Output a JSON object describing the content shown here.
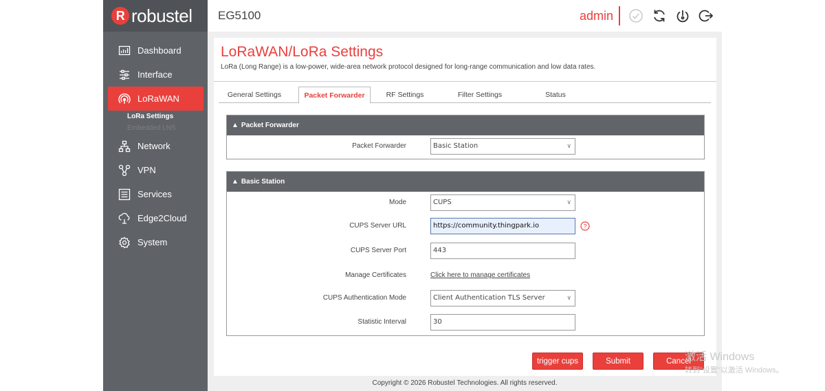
{
  "brand": {
    "logo_text": "robustel",
    "logo_mark": "R"
  },
  "header": {
    "device": "EG5100",
    "user": "admin",
    "icons": [
      "check-circle-icon",
      "refresh-icon",
      "power-icon",
      "logout-icon"
    ]
  },
  "sidebar": {
    "items": [
      {
        "label": "Dashboard",
        "icon": "dashboard-icon"
      },
      {
        "label": "Interface",
        "icon": "sliders-icon"
      },
      {
        "label": "LoRaWAN",
        "icon": "wireless-icon",
        "active": true
      },
      {
        "label": "Network",
        "icon": "network-icon"
      },
      {
        "label": "VPN",
        "icon": "vpn-icon"
      },
      {
        "label": "Services",
        "icon": "services-icon"
      },
      {
        "label": "Edge2Cloud",
        "icon": "cloud-icon"
      },
      {
        "label": "System",
        "icon": "gear-icon"
      }
    ],
    "subitems": [
      {
        "label": "LoRa Settings",
        "active": true
      },
      {
        "label": "Embedded LNS",
        "active": false
      }
    ]
  },
  "page": {
    "title": "LoRaWAN/LoRa Settings",
    "description": "LoRa (Long Range) is a low-power, wide-area network protocol designed for long-range communication and low data rates."
  },
  "tabs": [
    {
      "label": "General Settings"
    },
    {
      "label": "Packet Forwarder",
      "active": true
    },
    {
      "label": "RF Settings"
    },
    {
      "label": "Filter Settings"
    },
    {
      "label": "Status"
    }
  ],
  "packet_forwarder_section": {
    "heading": "Packet Forwarder",
    "label": "Packet Forwarder",
    "value": "Basic Station"
  },
  "basic_station_section": {
    "heading": "Basic Station",
    "mode_label": "Mode",
    "mode_value": "CUPS",
    "cups_url_label": "CUPS Server URL",
    "cups_url_value": "https://community.thingpark.io",
    "cups_port_label": "CUPS Server Port",
    "cups_port_value": "443",
    "certs_label": "Manage Certificates",
    "certs_link": "Click here to manage certificates",
    "auth_mode_label": "CUPS Authentication Mode",
    "auth_mode_value": "Client Authentication TLS Server",
    "stat_interval_label": "Statistic Interval",
    "stat_interval_value": "30"
  },
  "buttons": {
    "trigger": "trigger cups",
    "submit": "Submit",
    "cancel": "Cancel"
  },
  "footer": "Copyright © 2026 Robustel Technologies. All rights reserved.",
  "watermark": {
    "line1": "激活 Windows",
    "line2": "转到\"设置\"以激活 Windows。"
  },
  "colors": {
    "accent": "#e9403c",
    "sidebar": "#5f6368",
    "section_header": "#616469"
  }
}
